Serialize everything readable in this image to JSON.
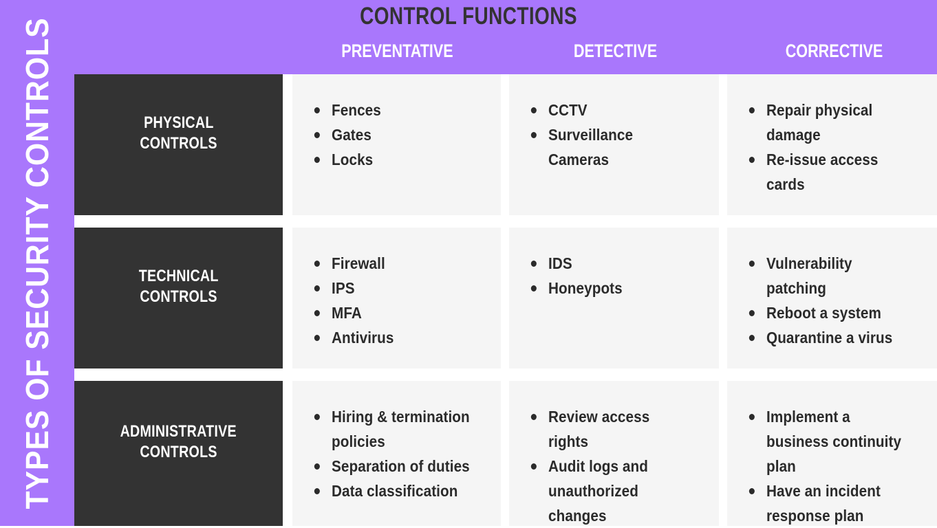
{
  "header": {
    "main_title": "CONTROL FUNCTIONS",
    "columns": [
      "PREVENTATIVE",
      "DETECTIVE",
      "CORRECTIVE"
    ]
  },
  "sidebar": {
    "label": "TYPES OF SECURITY CONTROLS"
  },
  "colors": {
    "accent_purple": "#a977fc",
    "row_label_bg": "#333333",
    "cell_bg": "#f5f5f5",
    "text_dark": "#2b2b2b",
    "text_light": "#ffffff"
  },
  "rows": [
    {
      "label_line1": "PHYSICAL",
      "label_line2": "CONTROLS",
      "cells": [
        {
          "items": [
            "Fences",
            "Gates",
            "Locks"
          ]
        },
        {
          "items": [
            "CCTV",
            "Surveillance Cameras"
          ]
        },
        {
          "items": [
            "Repair physical damage",
            "Re-issue access cards"
          ]
        }
      ]
    },
    {
      "label_line1": "TECHNICAL",
      "label_line2": "CONTROLS",
      "cells": [
        {
          "items": [
            "Firewall",
            "IPS",
            "MFA",
            "Antivirus"
          ]
        },
        {
          "items": [
            "IDS",
            "Honeypots"
          ]
        },
        {
          "items": [
            "Vulnerability patching",
            "Reboot a system",
            "Quarantine a virus"
          ]
        }
      ]
    },
    {
      "label_line1": "ADMINISTRATIVE",
      "label_line2": "CONTROLS",
      "cells": [
        {
          "items": [
            "Hiring & termination policies",
            "Separation of duties",
            "Data classification"
          ]
        },
        {
          "items": [
            "Review access rights",
            "Audit logs and unauthorized changes"
          ]
        },
        {
          "items": [
            "Implement a business continuity plan",
            "Have an incident response plan"
          ]
        }
      ]
    }
  ]
}
